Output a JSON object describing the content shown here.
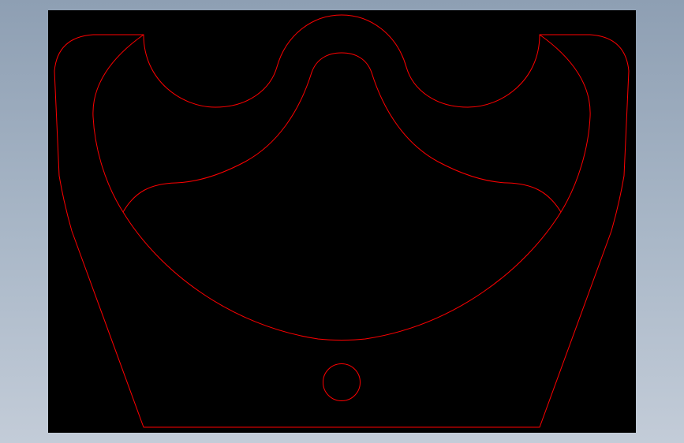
{
  "colors": {
    "background_gradient_top": "#8e9fb3",
    "background_gradient_bottom": "#c3ccd8",
    "viewport_background": "#000000",
    "line_color": "#ff0000"
  },
  "drawing": {
    "type": "2D CAD outline",
    "entities": [
      "outer-profile",
      "top-center-arc-outer",
      "top-center-arc-inner",
      "left-notch-arc",
      "right-notch-arc",
      "inner-top-curve",
      "bowl-arc",
      "left-inner-arc",
      "right-inner-arc",
      "mounting-hole-circle"
    ]
  }
}
